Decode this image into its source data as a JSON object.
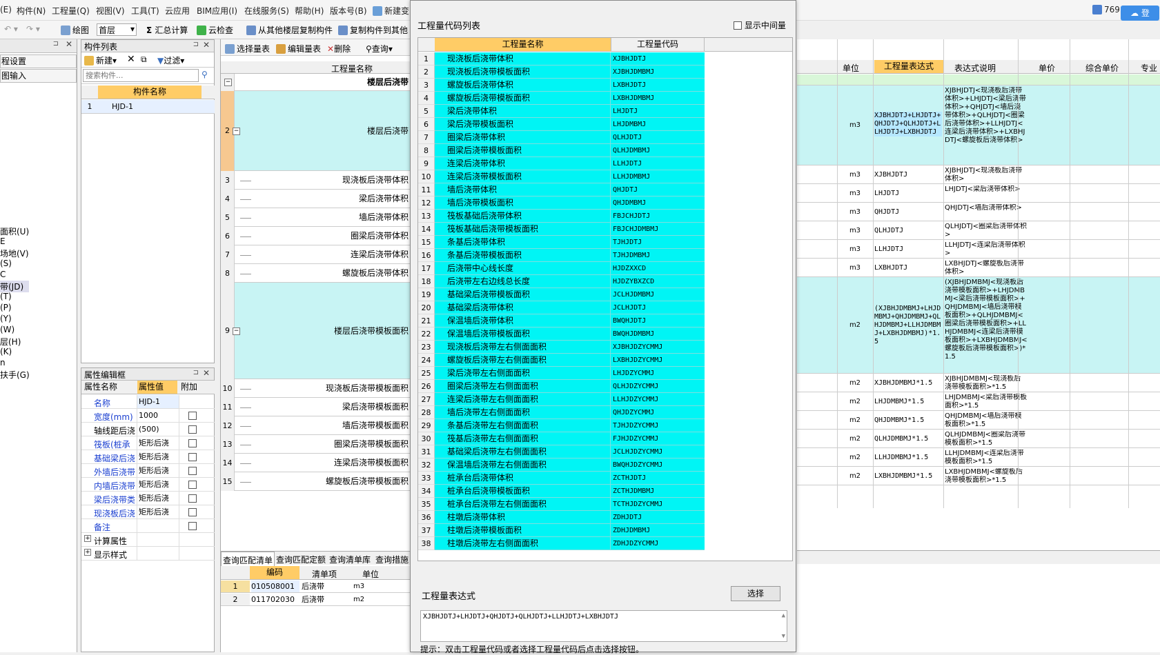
{
  "menu": [
    "(E)",
    "构件(N)",
    "工程量(Q)",
    "视图(V)",
    "工具(T)",
    "云应用",
    "BIM应用(I)",
    "在线服务(S)",
    "帮助(H)",
    "版本号(B)",
    "新建变"
  ],
  "toolbar": {
    "draw": "绘图",
    "floor": "首层",
    "sum": "汇总计算",
    "cloud_check": "云检查",
    "copy_from_floor": "从其他楼层复制构件",
    "copy_to_other": "复制构件到其他"
  },
  "user_badge": "769",
  "user_btn": "登",
  "left_strip": {
    "items": [
      "程设置",
      "图输入",
      "面积(U)",
      "E",
      "场地(V)",
      "(S)",
      "C",
      "带(JD)",
      "(T)",
      "(P)",
      "(Y)",
      "(W)",
      "层(H)",
      "(K)",
      "n",
      "扶手(G)"
    ]
  },
  "component_list": {
    "title": "构件列表",
    "new": "新建",
    "filter": "过滤",
    "search_placeholder": "搜索构件...",
    "header": "构件名称",
    "rows": [
      {
        "n": "1",
        "name": "HJD-1"
      }
    ]
  },
  "property_editor": {
    "title": "属性编辑框",
    "headers": [
      "属性名称",
      "属性值",
      "附加"
    ],
    "rows": [
      {
        "name": "名称",
        "value": "HJD-1"
      },
      {
        "name": "宽度(mm)",
        "value": "1000"
      },
      {
        "name": "轴线距后浇",
        "value": "(500)"
      },
      {
        "name": "筏板(桩承",
        "value": "矩形后浇"
      },
      {
        "name": "基础梁后浇",
        "value": "矩形后浇"
      },
      {
        "name": "外墙后浇带",
        "value": "矩形后浇"
      },
      {
        "name": "内墙后浇带",
        "value": "矩形后浇"
      },
      {
        "name": "梁后浇带类",
        "value": "矩形后浇"
      },
      {
        "name": "现浇板后浇",
        "value": "矩形后浇"
      },
      {
        "name": "备注",
        "value": ""
      },
      {
        "name": "计算属性",
        "value": ""
      },
      {
        "name": "显示样式",
        "value": ""
      }
    ]
  },
  "mid_toolbar": {
    "select_table": "选择量表",
    "edit_table": "编辑量表",
    "delete": "删除",
    "query": "查询"
  },
  "mid_table": {
    "header": "工程量名称",
    "rows": [
      {
        "n": "1",
        "name": "楼层后浇带"
      },
      {
        "n": "2",
        "name": "楼层后浇带"
      },
      {
        "n": "3",
        "name": "现浇板后浇带体积"
      },
      {
        "n": "4",
        "name": "梁后浇带体积"
      },
      {
        "n": "5",
        "name": "墙后浇带体积"
      },
      {
        "n": "6",
        "name": "圈梁后浇带体积"
      },
      {
        "n": "7",
        "name": "连梁后浇带体积"
      },
      {
        "n": "8",
        "name": "螺旋板后浇带体积"
      },
      {
        "n": "9",
        "name": "楼层后浇带模板面积"
      },
      {
        "n": "10",
        "name": "现浇板后浇带模板面积"
      },
      {
        "n": "11",
        "name": "梁后浇带模板面积"
      },
      {
        "n": "12",
        "name": "墙后浇带模板面积"
      },
      {
        "n": "13",
        "name": "圈梁后浇带模板面积"
      },
      {
        "n": "14",
        "name": "连梁后浇带模板面积"
      },
      {
        "n": "15",
        "name": "螺旋板后浇带模板面积"
      }
    ]
  },
  "bottom_tabs": [
    "查询匹配清单",
    "查询匹配定额",
    "查询清单库",
    "查询措施"
  ],
  "bottom_table": {
    "headers": [
      "编码",
      "清单项",
      "单位"
    ],
    "rows": [
      {
        "n": "1",
        "code": "010508001",
        "item": "后浇带",
        "unit": "m3"
      },
      {
        "n": "2",
        "code": "011702030",
        "item": "后浇带",
        "unit": "m2"
      }
    ]
  },
  "dialog": {
    "title": "工程量代码列表",
    "show_middle": "显示中间量",
    "col_name": "工程量名称",
    "col_code": "工程量代码",
    "rows": [
      [
        "1",
        "现浇板后浇带体积",
        "XJBHJDTJ"
      ],
      [
        "2",
        "现浇板后浇带模板面积",
        "XJBHJDMBMJ"
      ],
      [
        "3",
        "螺旋板后浇带体积",
        "LXBHJDTJ"
      ],
      [
        "4",
        "螺旋板后浇带模板面积",
        "LXBHJDMBMJ"
      ],
      [
        "5",
        "梁后浇带体积",
        "LHJDTJ"
      ],
      [
        "6",
        "梁后浇带模板面积",
        "LHJDMBMJ"
      ],
      [
        "7",
        "圈梁后浇带体积",
        "QLHJDTJ"
      ],
      [
        "8",
        "圈梁后浇带模板面积",
        "QLHJDMBMJ"
      ],
      [
        "9",
        "连梁后浇带体积",
        "LLHJDTJ"
      ],
      [
        "10",
        "连梁后浇带模板面积",
        "LLHJDMBMJ"
      ],
      [
        "11",
        "墙后浇带体积",
        "QHJDTJ"
      ],
      [
        "12",
        "墙后浇带模板面积",
        "QHJDMBMJ"
      ],
      [
        "13",
        "筏板基础后浇带体积",
        "FBJCHJDTJ"
      ],
      [
        "14",
        "筏板基础后浇带模板面积",
        "FBJCHJDMBMJ"
      ],
      [
        "15",
        "条基后浇带体积",
        "TJHJDTJ"
      ],
      [
        "16",
        "条基后浇带模板面积",
        "TJHJDMBMJ"
      ],
      [
        "17",
        "后浇带中心线长度",
        "HJDZXXCD"
      ],
      [
        "18",
        "后浇带左右边线总长度",
        "HJDZYBXZCD"
      ],
      [
        "19",
        "基础梁后浇带模板面积",
        "JCLHJDMBMJ"
      ],
      [
        "20",
        "基础梁后浇带体积",
        "JCLHJDTJ"
      ],
      [
        "21",
        "保温墙后浇带体积",
        "BWQHJDTJ"
      ],
      [
        "22",
        "保温墙后浇带模板面积",
        "BWQHJDMBMJ"
      ],
      [
        "23",
        "现浇板后浇带左右侧面面积",
        "XJBHJDZYCMMJ"
      ],
      [
        "24",
        "螺旋板后浇带左右侧面面积",
        "LXBHJDZYCMMJ"
      ],
      [
        "25",
        "梁后浇带左右侧面面积",
        "LHJDZYCMMJ"
      ],
      [
        "26",
        "圈梁后浇带左右侧面面积",
        "QLHJDZYCMMJ"
      ],
      [
        "27",
        "连梁后浇带左右侧面面积",
        "LLHJDZYCMMJ"
      ],
      [
        "28",
        "墙后浇带左右侧面面积",
        "QHJDZYCMMJ"
      ],
      [
        "29",
        "条基后浇带左右侧面面积",
        "TJHJDZYCMMJ"
      ],
      [
        "30",
        "筏基后浇带左右侧面面积",
        "FJHJDZYCMMJ"
      ],
      [
        "31",
        "基础梁后浇带左右侧面面积",
        "JCLHJDZYCMMJ"
      ],
      [
        "32",
        "保温墙后浇带左右侧面面积",
        "BWQHJDZYCMMJ"
      ],
      [
        "33",
        "桩承台后浇带体积",
        "ZCTHJDTJ"
      ],
      [
        "34",
        "桩承台后浇带模板面积",
        "ZCTHJDMBMJ"
      ],
      [
        "35",
        "桩承台后浇带左右侧面面积",
        "TCTHJDZYCMMJ"
      ],
      [
        "36",
        "柱墩后浇带体积",
        "ZDHJDTJ"
      ],
      [
        "37",
        "柱墩后浇带模板面积",
        "ZDHJDMBMJ"
      ],
      [
        "38",
        "柱墩后浇带左右侧面面积",
        "ZDHJDZYCMMJ"
      ]
    ],
    "expr_label": "工程量表达式",
    "select_btn": "选择",
    "expr_value": "XJBHJDTJ+LHJDTJ+QHJDTJ+QLHJDTJ+LLHJDTJ+LXBHJDTJ",
    "hint": "提示：双击工程量代码或者选择工程量代码后点击选择按钮。"
  },
  "right_table": {
    "headers": [
      "单位",
      "工程量表达式",
      "表达式说明",
      "单价",
      "综合单价",
      "专业"
    ],
    "rows": [
      {
        "unit": "m3",
        "expr": "XJBHJDTJ+LHJDTJ+QHJDTJ+QLHJDTJ+LLHJDTJ+LXBHJDTJ",
        "desc": "XJBHJDTJ<现浇板后浇带体积>+LHJDTJ<梁后浇带体积>+QHJDTJ<墙后浇带体积>+QLHJDTJ<圈梁后浇带体积>+LLHJDTJ<连梁后浇带体积>+LXBHJDTJ<螺旋板后浇带体积>"
      },
      {
        "unit": "m3",
        "expr": "XJBHJDTJ",
        "desc": "XJBHJDTJ<现浇板后浇带体积>"
      },
      {
        "unit": "m3",
        "expr": "LHJDTJ",
        "desc": "LHJDTJ<梁后浇带体积>"
      },
      {
        "unit": "m3",
        "expr": "QHJDTJ",
        "desc": "QHJDTJ<墙后浇带体积>"
      },
      {
        "unit": "m3",
        "expr": "QLHJDTJ",
        "desc": "QLHJDTJ<圈梁后浇带体积>"
      },
      {
        "unit": "m3",
        "expr": "LLHJDTJ",
        "desc": "LLHJDTJ<连梁后浇带体积>"
      },
      {
        "unit": "m3",
        "expr": "LXBHJDTJ",
        "desc": "LXBHJDTJ<螺旋板后浇带体积>"
      },
      {
        "unit": "m2",
        "expr": "(XJBHJDMBMJ+LHJDMBMJ+QHJDMBMJ+QLHJDMBMJ+LLHJDMBMJ+LXBHJDMBMJ)*1.5",
        "desc": "(XJBHJDMBMJ<现浇板后浇带模板面积>+LHJDMBMJ<梁后浇带模板面积>+QHJDMBMJ<墙后浇带模板面积>+QLHJDMBMJ<圈梁后浇带模板面积>+LLHJDMBMJ<连梁后浇带模板面积>+LXBHJDMBMJ<螺旋板后浇带模板面积>)*1.5"
      },
      {
        "unit": "m2",
        "expr": "XJBHJDMBMJ*1.5",
        "desc": "XJBHJDMBMJ<现浇板后浇带模板面积>*1.5"
      },
      {
        "unit": "m2",
        "expr": "LHJDMBMJ*1.5",
        "desc": "LHJDMBMJ<梁后浇带模板面积>*1.5"
      },
      {
        "unit": "m2",
        "expr": "QHJDMBMJ*1.5",
        "desc": "QHJDMBMJ<墙后浇带模板面积>*1.5"
      },
      {
        "unit": "m2",
        "expr": "QLHJDMBMJ*1.5",
        "desc": "QLHJDMBMJ<圈梁后浇带模板面积>*1.5"
      },
      {
        "unit": "m2",
        "expr": "LLHJDMBMJ*1.5",
        "desc": "LLHJDMBMJ<连梁后浇带模板面积>*1.5"
      },
      {
        "unit": "m2",
        "expr": "LXBHJDMBMJ*1.5",
        "desc": "LXBHJDMBMJ<螺旋板后浇带模板面积>*1.5"
      }
    ]
  }
}
